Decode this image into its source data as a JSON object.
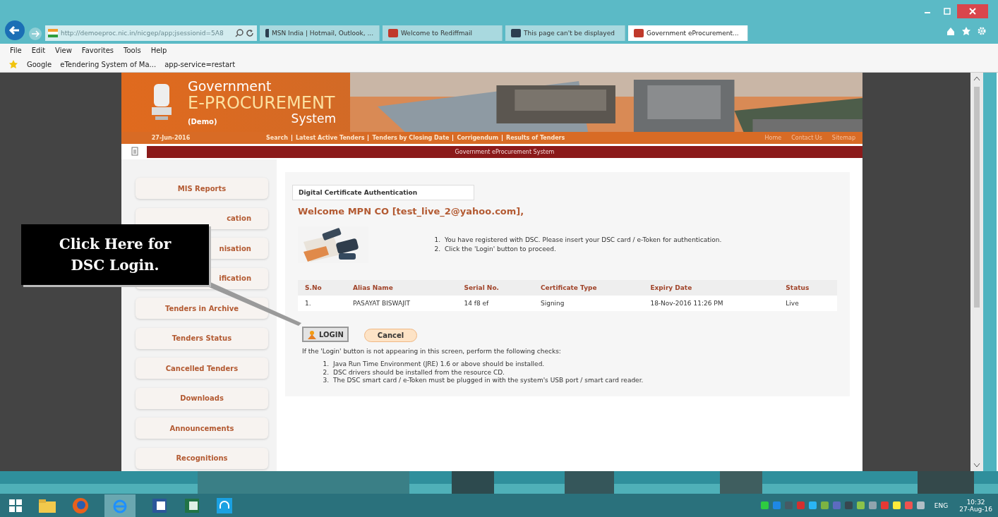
{
  "browser": {
    "address": "http://demoeproc.nic.in/nicgep/app;jsessionid=5A8",
    "tabs": [
      {
        "title": "MSN India | Hotmail, Outlook, ...",
        "selected": false
      },
      {
        "title": "Welcome to Rediffmail",
        "selected": false
      },
      {
        "title": "This page can't be displayed",
        "selected": false
      },
      {
        "title": "Government eProcurement...",
        "selected": true
      }
    ],
    "menu": [
      "File",
      "Edit",
      "View",
      "Favorites",
      "Tools",
      "Help"
    ],
    "favorites": [
      "Google",
      "eTendering System of Ma...",
      "app-service=restart"
    ]
  },
  "header": {
    "title": "Government",
    "subtitle": "E-PROCUREMENT",
    "system": "System",
    "demo": "(Demo)"
  },
  "navbar": {
    "date": "27-Jun-2016",
    "links": [
      "Search",
      "Latest Active Tenders",
      "Tenders by Closing Date",
      "Corrigendum",
      "Results of Tenders"
    ],
    "right_links": [
      "Home",
      "Contact Us",
      "Sitemap"
    ]
  },
  "banner_text": "Government eProcurement System",
  "sidebar": [
    {
      "label": "MIS Reports",
      "kind": "full"
    },
    {
      "label": "cation",
      "kind": "partial"
    },
    {
      "label": "nisation",
      "kind": "partial"
    },
    {
      "label": "ification",
      "kind": "partial"
    },
    {
      "label": "Tenders in Archive",
      "kind": "full"
    },
    {
      "label": "Tenders Status",
      "kind": "full"
    },
    {
      "label": "Cancelled Tenders",
      "kind": "full"
    },
    {
      "label": "Downloads",
      "kind": "full"
    },
    {
      "label": "Announcements",
      "kind": "full"
    },
    {
      "label": "Recognitions",
      "kind": "full"
    }
  ],
  "panel": {
    "tab": "Digital Certificate Authentication",
    "welcome": "Welcome MPN CO [test_live_2@yahoo.com],",
    "instructions": [
      {
        "number": "1.",
        "text": "You have registered with DSC. Please insert your DSC card / e-Token for authentication."
      },
      {
        "number": "2.",
        "text": "Click the 'Login' button to proceed."
      }
    ],
    "table": {
      "columns": [
        "S.No",
        "Alias Name",
        "Serial No.",
        "Certificate Type",
        "Expiry Date",
        "Status"
      ],
      "rows": [
        [
          "1.",
          "PASAYAT BISWAJIT",
          "14 f8 ef",
          "Signing",
          "18-Nov-2016 11:26 PM",
          "Live"
        ]
      ]
    },
    "login_button": "LOGIN",
    "cancel_button": "Cancel",
    "note": "If the 'Login' button is not appearing in this screen, perform the following checks:",
    "checks": [
      {
        "number": "1.",
        "text": "Java Run Time Environment (JRE) 1.6 or above should be installed."
      },
      {
        "number": "2.",
        "text": "DSC drivers should be installed from the resource CD."
      },
      {
        "number": "3.",
        "text": "The DSC smart card / e-Token must be plugged in with the system's USB port / smart card reader."
      }
    ]
  },
  "callout": "Click Here for DSC Login.",
  "tray": {
    "language": "ENG",
    "time": "10:32",
    "date": "27-Aug-16"
  }
}
